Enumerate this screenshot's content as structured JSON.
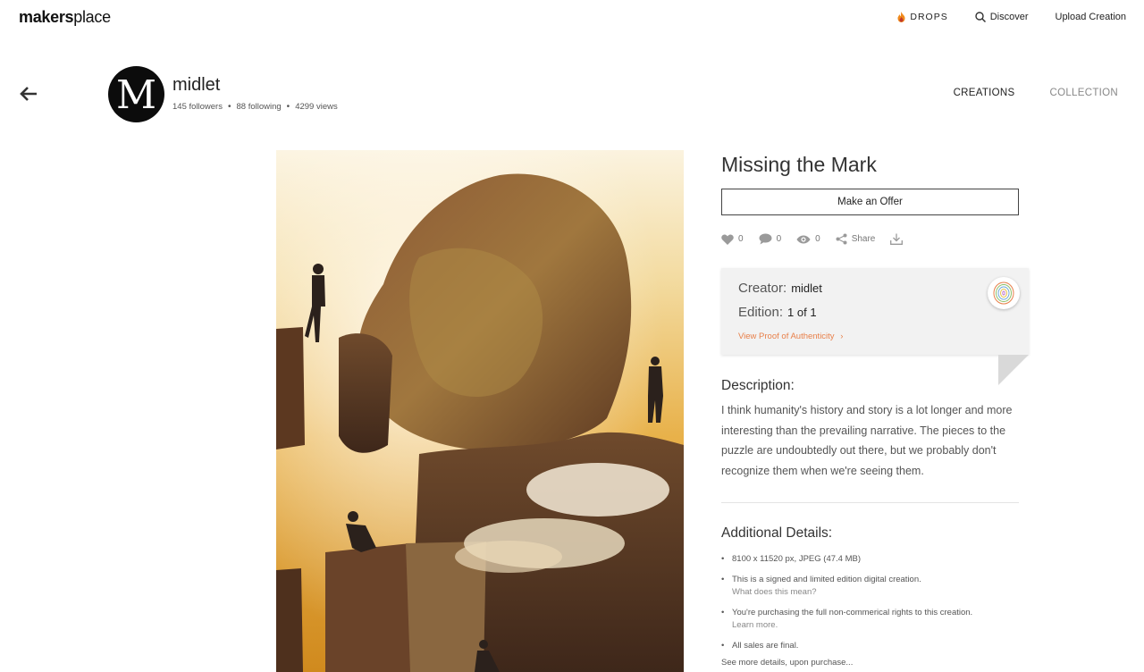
{
  "nav": {
    "logo_bold": "makers",
    "logo_light": "place",
    "drops": "DROPS",
    "discover": "Discover",
    "upload": "Upload Creation"
  },
  "profile": {
    "avatar_letter": "M",
    "username": "midlet",
    "followers": "145 followers",
    "following": "88 following",
    "views": "4299 views",
    "tabs": [
      "CREATIONS",
      "COLLECTION"
    ]
  },
  "creation": {
    "title": "Missing the Mark",
    "offer_label": "Make an Offer",
    "likes": "0",
    "comments": "0",
    "view_count": "0",
    "share_label": "Share"
  },
  "card": {
    "creator_label": "Creator:",
    "creator_value": "midlet",
    "edition_label": "Edition:",
    "edition_value": "1 of 1",
    "proof_link": "View Proof of Authenticity",
    "proof_chevron": "›"
  },
  "description": {
    "heading": "Description:",
    "text": "I think humanity's history and story is a lot longer and more interesting than the prevailing narrative. The pieces to the puzzle are undoubtedly out there, but we probably don't recognize them when we're seeing them."
  },
  "details": {
    "heading": "Additional Details:",
    "item1": "8100 x 11520 px, JPEG (47.4 MB)",
    "item2": "This is a signed and limited edition digital creation.",
    "item2_sub": "What does this mean?",
    "item3": "You're purchasing the full non-commerical rights to this creation.",
    "item3_sub": "Learn more.",
    "item4": "All sales are final.",
    "more": "See more details, upon purchase..."
  },
  "colors": {
    "accent": "#e8804a",
    "drops_flame": "#f08a1c",
    "card_bg": "#f2f2f2",
    "text_dark": "#222222"
  }
}
